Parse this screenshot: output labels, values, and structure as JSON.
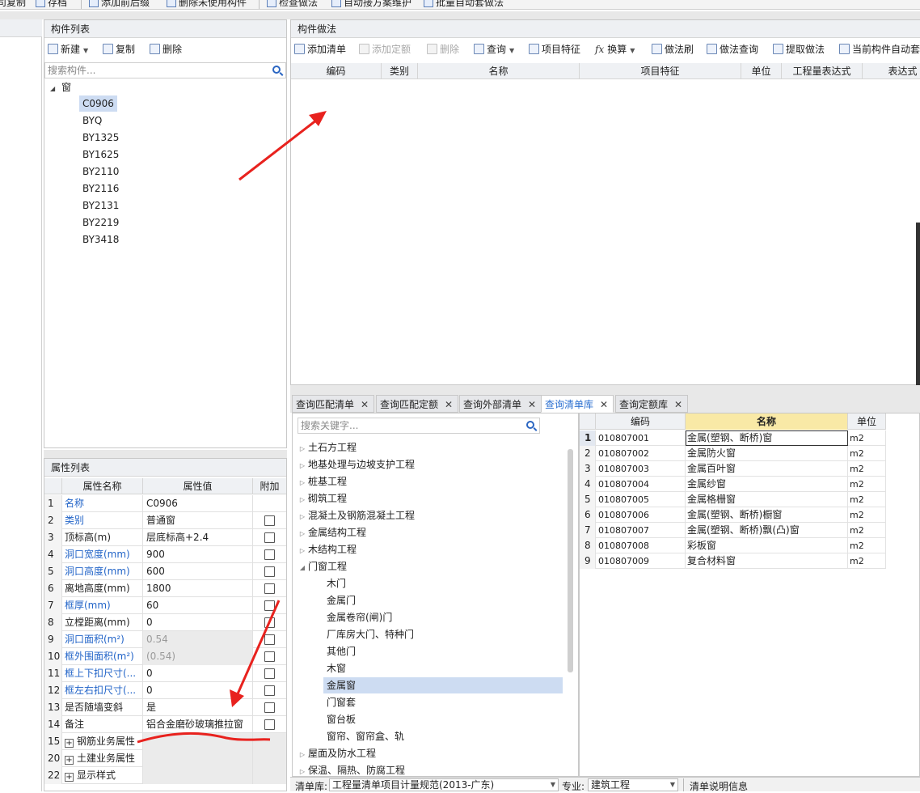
{
  "toolbar": {
    "items": [
      "司复制",
      "存档",
      "添加前后缀",
      "删除未使用构件",
      "检查做法",
      "自动接方案维护",
      "批量自动套做法"
    ]
  },
  "component_list": {
    "title": "构件列表",
    "new_label": "新建",
    "copy_label": "复制",
    "delete_label": "删除",
    "search_placeholder": "搜索构件...",
    "root": "窗",
    "items": [
      "C0906",
      "BYQ",
      "BY1325",
      "BY1625",
      "BY2110",
      "BY2116",
      "BY2131",
      "BY2219",
      "BY3418"
    ],
    "selected": "C0906"
  },
  "method": {
    "title": "构件做法",
    "tools": [
      "添加清单",
      "添加定额",
      "删除",
      "查询",
      "项目特征",
      "换算",
      "做法刷",
      "做法查询",
      "提取做法",
      "当前构件自动套"
    ],
    "headers": [
      "编码",
      "类别",
      "名称",
      "项目特征",
      "单位",
      "工程量表达式",
      "表达式"
    ]
  },
  "props": {
    "title": "属性列表",
    "headers": [
      "属性名称",
      "属性值",
      "附加"
    ],
    "rows": [
      {
        "n": "1",
        "name": "名称",
        "value": "C0906",
        "blue": true,
        "chk": false,
        "gray": false
      },
      {
        "n": "2",
        "name": "类别",
        "value": "普通窗",
        "blue": true,
        "chk": true,
        "gray": false
      },
      {
        "n": "3",
        "name": "顶标高(m)",
        "value": "层底标高+2.4",
        "blue": false,
        "chk": true,
        "gray": false
      },
      {
        "n": "4",
        "name": "洞口宽度(mm)",
        "value": "900",
        "blue": true,
        "chk": true,
        "gray": false
      },
      {
        "n": "5",
        "name": "洞口高度(mm)",
        "value": "600",
        "blue": true,
        "chk": true,
        "gray": false
      },
      {
        "n": "6",
        "name": "离地高度(mm)",
        "value": "1800",
        "blue": false,
        "chk": true,
        "gray": false
      },
      {
        "n": "7",
        "name": "框厚(mm)",
        "value": "60",
        "blue": true,
        "chk": true,
        "gray": false
      },
      {
        "n": "8",
        "name": "立樘距离(mm)",
        "value": "0",
        "blue": false,
        "chk": true,
        "gray": false
      },
      {
        "n": "9",
        "name": "洞口面积(m²)",
        "value": "0.54",
        "blue": true,
        "chk": true,
        "gray": true
      },
      {
        "n": "10",
        "name": "框外围面积(m²)",
        "value": "(0.54)",
        "blue": true,
        "chk": true,
        "gray": true
      },
      {
        "n": "11",
        "name": "框上下扣尺寸(...",
        "value": "0",
        "blue": true,
        "chk": true,
        "gray": false
      },
      {
        "n": "12",
        "name": "框左右扣尺寸(...",
        "value": "0",
        "blue": true,
        "chk": true,
        "gray": false
      },
      {
        "n": "13",
        "name": "是否随墙变斜",
        "value": "是",
        "blue": false,
        "chk": true,
        "gray": false
      },
      {
        "n": "14",
        "name": "备注",
        "value": "铝合金磨砂玻璃推拉窗",
        "blue": false,
        "chk": true,
        "gray": false
      }
    ],
    "groups": [
      {
        "n": "15",
        "name": "钢筋业务属性"
      },
      {
        "n": "20",
        "name": "土建业务属性"
      },
      {
        "n": "22",
        "name": "显示样式"
      }
    ]
  },
  "tabs": [
    {
      "label": "查询匹配清单",
      "active": false
    },
    {
      "label": "查询匹配定额",
      "active": false
    },
    {
      "label": "查询外部清单",
      "active": false
    },
    {
      "label": "查询清单库",
      "active": true
    },
    {
      "label": "查询定额库",
      "active": false
    }
  ],
  "library": {
    "search_placeholder": "搜索关键字...",
    "categories": [
      "土石方工程",
      "地基处理与边坡支护工程",
      "桩基工程",
      "砌筑工程",
      "混凝土及钢筋混凝土工程",
      "金属结构工程",
      "木结构工程"
    ],
    "expanded": "门窗工程",
    "children": [
      "木门",
      "金属门",
      "金属卷帘(闸)门",
      "厂库房大门、特种门",
      "其他门",
      "木窗",
      "金属窗",
      "门窗套",
      "窗台板",
      "窗帘、窗帘盒、轨"
    ],
    "selected_child": "金属窗",
    "after": [
      "屋面及防水工程",
      "保温、隔热、防腐工程"
    ]
  },
  "results": {
    "headers": [
      "编码",
      "名称",
      "单位"
    ],
    "rows": [
      {
        "n": "1",
        "code": "010807001",
        "name": "金属(塑钢、断桥)窗",
        "unit": "m2"
      },
      {
        "n": "2",
        "code": "010807002",
        "name": "金属防火窗",
        "unit": "m2"
      },
      {
        "n": "3",
        "code": "010807003",
        "name": "金属百叶窗",
        "unit": "m2"
      },
      {
        "n": "4",
        "code": "010807004",
        "name": "金属纱窗",
        "unit": "m2"
      },
      {
        "n": "5",
        "code": "010807005",
        "name": "金属格栅窗",
        "unit": "m2"
      },
      {
        "n": "6",
        "code": "010807006",
        "name": "金属(塑钢、断桥)橱窗",
        "unit": "m2"
      },
      {
        "n": "7",
        "code": "010807007",
        "name": "金属(塑钢、断桥)飘(凸)窗",
        "unit": "m2"
      },
      {
        "n": "8",
        "code": "010807008",
        "name": "彩板窗",
        "unit": "m2"
      },
      {
        "n": "9",
        "code": "010807009",
        "name": "复合材料窗",
        "unit": "m2"
      }
    ]
  },
  "footer": {
    "list_label": "清单库:",
    "list_value": "工程量清单项目计量规范(2013-广东)",
    "spec_label": "专业:",
    "spec_value": "建筑工程",
    "info_label": "清单说明信息"
  },
  "colors": {
    "accent": "#2b6fd0",
    "annotation": "#e8221e",
    "selected_bg": "#cddcf2"
  }
}
